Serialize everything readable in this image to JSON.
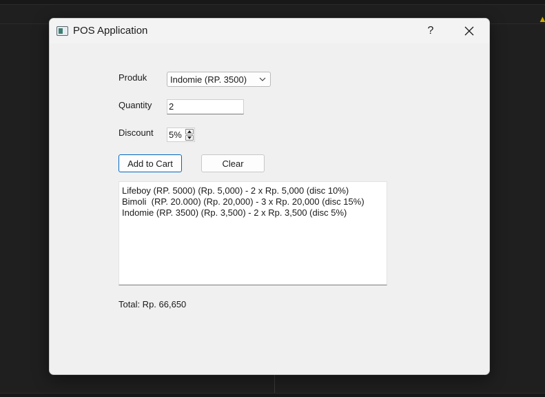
{
  "window": {
    "title": "POS Application",
    "help_label": "?"
  },
  "form": {
    "produk_label": "Produk",
    "produk_selected": "Indomie (RP. 3500)",
    "quantity_label": "Quantity",
    "quantity_value": "2",
    "discount_label": "Discount",
    "discount_value": "5%"
  },
  "buttons": {
    "add_to_cart": "Add to Cart",
    "clear": "Clear"
  },
  "cart": {
    "items": [
      "Lifeboy (RP. 5000) (Rp. 5,000) - 2 x Rp. 5,000 (disc 10%)",
      "Bimoli  (RP. 20.000) (Rp. 20,000) - 3 x Rp. 20,000 (disc 15%)",
      "Indomie (RP. 3500) (Rp. 3,500) - 2 x Rp. 3,500 (disc 5%)"
    ]
  },
  "total_text": "Total: Rp. 66,650",
  "icons": {
    "app": "window-app-icon",
    "close": "close-icon",
    "dropdown": "chevron-down-icon",
    "spin_up": "spin-up-arrow-icon",
    "spin_down": "spin-down-arrow-icon",
    "background_warning": "warning-icon"
  },
  "colors": {
    "accent": "#0067c0",
    "dialog_bg": "#f0f0f0",
    "background_app": "#1f1f1f"
  }
}
